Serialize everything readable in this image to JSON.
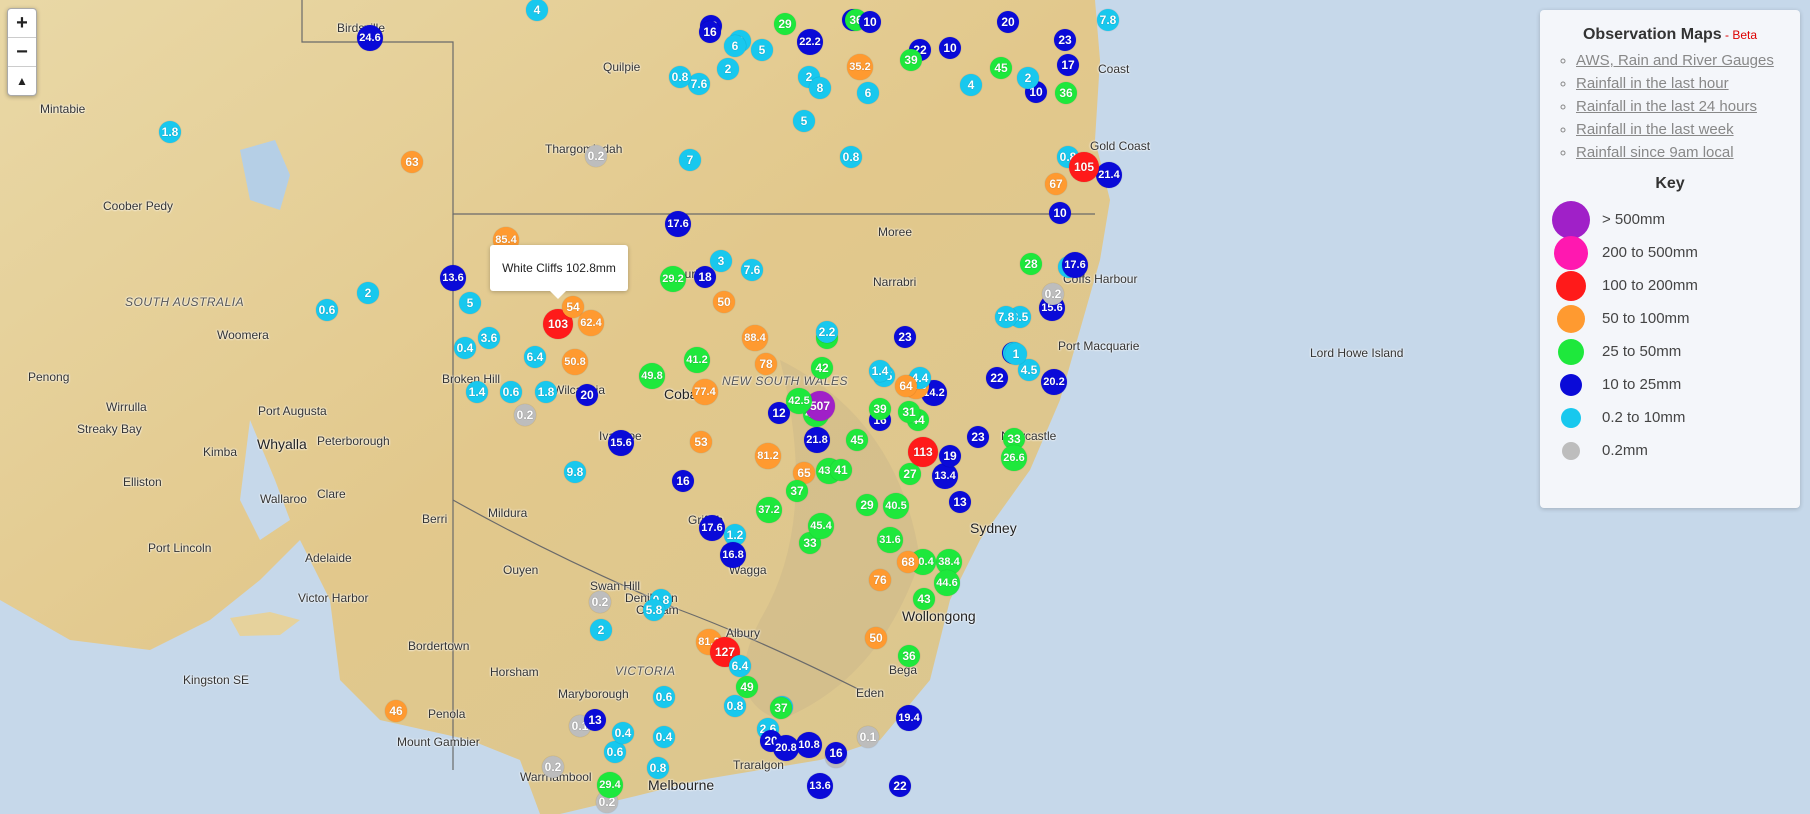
{
  "map": {
    "zoom_in": "+",
    "zoom_out": "−",
    "reset_north": "▲",
    "tooltip": "White Cliffs 102.8mm",
    "place_labels": [
      "Birdsville",
      "Quilpie",
      "Mintabie",
      "Thargomindah",
      "Coober Pedy",
      "SOUTH AUSTRALIA",
      "Woomera",
      "Penong",
      "Wirrulla",
      "Streaky Bay",
      "Port Augusta",
      "Whyalla",
      "Peterborough",
      "Kimba",
      "Elliston",
      "Wallaroo",
      "Clare",
      "Port Lincoln",
      "Adelaide",
      "Victor Harbor",
      "Kingston SE",
      "Bordertown",
      "Horsham",
      "Mount Gambier",
      "Penola",
      "Warrnambool",
      "Maryborough",
      "VICTORIA",
      "Cobram",
      "Deniliquin",
      "Swan Hill",
      "Ouyen",
      "Mildura",
      "Berri",
      "Broken Hill",
      "Wilcannia",
      "NEW SOUTH WALES",
      "Ivanhoe",
      "Cobar",
      "Moree",
      "Narrabri",
      "Griffith",
      "Wagga",
      "Albury",
      "Coffs Harbour",
      "Port Macquarie",
      "Newcastle",
      "Sydney",
      "Wollongong",
      "Eden",
      "Traralgon",
      "Melbourne",
      "Bega",
      "Lord Howe Island",
      "Coast",
      "Gold Coast",
      "Bourke"
    ],
    "markers": [
      {
        "v": "24.6",
        "c": "navy"
      },
      {
        "v": "4",
        "c": "cyan"
      },
      {
        "v": "1.8",
        "c": "cyan"
      },
      {
        "v": "63",
        "c": "orange"
      },
      {
        "v": "0.2",
        "c": "grey"
      },
      {
        "v": "7",
        "c": "cyan"
      },
      {
        "v": "0.8",
        "c": "cyan"
      },
      {
        "v": "2",
        "c": "cyan"
      },
      {
        "v": "0.6",
        "c": "cyan"
      },
      {
        "v": "13.6",
        "c": "navy"
      },
      {
        "v": "5",
        "c": "cyan"
      },
      {
        "v": "85.4",
        "c": "orange"
      },
      {
        "v": "3.6",
        "c": "cyan"
      },
      {
        "v": "0.4",
        "c": "cyan"
      },
      {
        "v": "1.4",
        "c": "cyan"
      },
      {
        "v": "0.6",
        "c": "cyan"
      },
      {
        "v": "0.2",
        "c": "grey"
      },
      {
        "v": "1.8",
        "c": "cyan"
      },
      {
        "v": "20",
        "c": "navy"
      },
      {
        "v": "6.4",
        "c": "cyan"
      },
      {
        "v": "50.8",
        "c": "orange"
      },
      {
        "v": "103",
        "c": "red"
      },
      {
        "v": "54",
        "c": "orange"
      },
      {
        "v": "62.4",
        "c": "orange"
      },
      {
        "v": "17.6",
        "c": "navy"
      },
      {
        "v": "3",
        "c": "cyan"
      },
      {
        "v": "29.2",
        "c": "green"
      },
      {
        "v": "18",
        "c": "navy"
      },
      {
        "v": "7.6",
        "c": "cyan"
      },
      {
        "v": "50",
        "c": "orange"
      },
      {
        "v": "88.4",
        "c": "orange"
      },
      {
        "v": "78",
        "c": "orange"
      },
      {
        "v": "49.8",
        "c": "green"
      },
      {
        "v": "41.2",
        "c": "green"
      },
      {
        "v": "77.4",
        "c": "orange"
      },
      {
        "v": "53",
        "c": "orange"
      },
      {
        "v": "15.6",
        "c": "navy"
      },
      {
        "v": "9.8",
        "c": "cyan"
      },
      {
        "v": "16",
        "c": "navy"
      },
      {
        "v": "81.2",
        "c": "orange"
      },
      {
        "v": "65",
        "c": "orange"
      },
      {
        "v": "37.2",
        "c": "green"
      },
      {
        "v": "17.6",
        "c": "navy"
      },
      {
        "v": "1.2",
        "c": "cyan"
      },
      {
        "v": "16.8",
        "c": "navy"
      },
      {
        "v": "0.8",
        "c": "cyan"
      },
      {
        "v": "5.8",
        "c": "cyan"
      },
      {
        "v": "2",
        "c": "cyan"
      },
      {
        "v": "0.1",
        "c": "grey"
      },
      {
        "v": "0.2",
        "c": "grey"
      },
      {
        "v": "0.2",
        "c": "grey"
      },
      {
        "v": "0.6",
        "c": "cyan"
      },
      {
        "v": "0.4",
        "c": "cyan"
      },
      {
        "v": "0.8",
        "c": "cyan"
      },
      {
        "v": "0.6",
        "c": "cyan"
      },
      {
        "v": "0.2",
        "c": "grey"
      },
      {
        "v": "0.4",
        "c": "cyan"
      },
      {
        "v": "0.8",
        "c": "cyan"
      },
      {
        "v": "3.8",
        "c": "cyan"
      },
      {
        "v": "0.2",
        "c": "grey"
      },
      {
        "v": "0.1",
        "c": "grey"
      },
      {
        "v": "22",
        "c": "navy"
      },
      {
        "v": "29.4",
        "c": "green"
      },
      {
        "v": "13",
        "c": "navy"
      },
      {
        "v": "46",
        "c": "orange"
      },
      {
        "v": "81.2",
        "c": "orange"
      },
      {
        "v": "127",
        "c": "red"
      },
      {
        "v": "6.4",
        "c": "cyan"
      },
      {
        "v": "49",
        "c": "green"
      },
      {
        "v": "37",
        "c": "green"
      },
      {
        "v": "2.6",
        "c": "cyan"
      },
      {
        "v": "20",
        "c": "navy"
      },
      {
        "v": "20.8",
        "c": "navy"
      },
      {
        "v": "10.8",
        "c": "navy"
      },
      {
        "v": "13.6",
        "c": "navy"
      },
      {
        "v": "16",
        "c": "navy"
      },
      {
        "v": "19.4",
        "c": "navy"
      },
      {
        "v": "36",
        "c": "green"
      },
      {
        "v": "50",
        "c": "orange"
      },
      {
        "v": "43",
        "c": "green"
      },
      {
        "v": "38.4",
        "c": "green"
      },
      {
        "v": "44.6",
        "c": "green"
      },
      {
        "v": "30.4",
        "c": "green"
      },
      {
        "v": "68",
        "c": "orange"
      },
      {
        "v": "76",
        "c": "orange"
      },
      {
        "v": "33",
        "c": "green"
      },
      {
        "v": "45.4",
        "c": "green"
      },
      {
        "v": "31.6",
        "c": "green"
      },
      {
        "v": "29",
        "c": "green"
      },
      {
        "v": "43.2",
        "c": "green"
      },
      {
        "v": "21.8",
        "c": "navy"
      },
      {
        "v": "48.4",
        "c": "green"
      },
      {
        "v": "37",
        "c": "green"
      },
      {
        "v": "41",
        "c": "green"
      },
      {
        "v": "45",
        "c": "green"
      },
      {
        "v": "40.5",
        "c": "green"
      },
      {
        "v": "27",
        "c": "green"
      },
      {
        "v": "13.4",
        "c": "navy"
      },
      {
        "v": "13",
        "c": "navy"
      },
      {
        "v": "23",
        "c": "navy"
      },
      {
        "v": "19",
        "c": "navy"
      },
      {
        "v": "113",
        "c": "red"
      },
      {
        "v": "44",
        "c": "green"
      },
      {
        "v": "33",
        "c": "green"
      },
      {
        "v": "26.6",
        "c": "green"
      },
      {
        "v": "16",
        "c": "navy"
      },
      {
        "v": "31",
        "c": "green"
      },
      {
        "v": "39",
        "c": "green"
      },
      {
        "v": "14.2",
        "c": "navy"
      },
      {
        "v": "51.6",
        "c": "orange"
      },
      {
        "v": "4.4",
        "c": "cyan"
      },
      {
        "v": "42",
        "c": "green"
      },
      {
        "v": "507",
        "c": "purple"
      },
      {
        "v": "2.5",
        "c": "cyan"
      },
      {
        "v": "64",
        "c": "orange"
      },
      {
        "v": "12",
        "c": "navy"
      },
      {
        "v": "42.5",
        "c": "green"
      },
      {
        "v": "35",
        "c": "green"
      },
      {
        "v": "23",
        "c": "navy"
      },
      {
        "v": "22",
        "c": "navy"
      },
      {
        "v": "10",
        "c": "navy"
      },
      {
        "v": "4.5",
        "c": "cyan"
      },
      {
        "v": "3.5",
        "c": "cyan"
      },
      {
        "v": "15.6",
        "c": "navy"
      },
      {
        "v": "9.8",
        "c": "cyan"
      },
      {
        "v": "7.8",
        "c": "cyan"
      },
      {
        "v": "1.4",
        "c": "cyan"
      },
      {
        "v": "2",
        "c": "cyan"
      },
      {
        "v": "1",
        "c": "cyan"
      },
      {
        "v": "0.2",
        "c": "grey"
      },
      {
        "v": "17.6",
        "c": "navy"
      },
      {
        "v": "20.2",
        "c": "navy"
      },
      {
        "v": "28",
        "c": "green"
      },
      {
        "v": "10",
        "c": "navy"
      },
      {
        "v": "0.8",
        "c": "cyan"
      },
      {
        "v": "2.2",
        "c": "cyan"
      },
      {
        "v": "21.4",
        "c": "navy"
      },
      {
        "v": "105",
        "c": "red"
      },
      {
        "v": "67",
        "c": "orange"
      },
      {
        "v": "36",
        "c": "green"
      },
      {
        "v": "23",
        "c": "navy"
      },
      {
        "v": "17",
        "c": "navy"
      },
      {
        "v": "45",
        "c": "green"
      },
      {
        "v": "10",
        "c": "navy"
      },
      {
        "v": "20",
        "c": "navy"
      },
      {
        "v": "18",
        "c": "navy"
      },
      {
        "v": "22.2",
        "c": "navy"
      },
      {
        "v": "36",
        "c": "green"
      },
      {
        "v": "35.2",
        "c": "orange"
      },
      {
        "v": "22",
        "c": "navy"
      },
      {
        "v": "29",
        "c": "green"
      },
      {
        "v": "2",
        "c": "cyan"
      },
      {
        "v": "6",
        "c": "cyan"
      },
      {
        "v": "39",
        "c": "green"
      },
      {
        "v": "8",
        "c": "cyan"
      },
      {
        "v": "4",
        "c": "cyan"
      },
      {
        "v": "10",
        "c": "navy"
      },
      {
        "v": "5",
        "c": "cyan"
      },
      {
        "v": "7.8",
        "c": "cyan"
      },
      {
        "v": "10",
        "c": "navy"
      },
      {
        "v": "2",
        "c": "cyan"
      },
      {
        "v": "7.6",
        "c": "cyan"
      },
      {
        "v": "2",
        "c": "cyan"
      },
      {
        "v": "6",
        "c": "cyan"
      },
      {
        "v": "5",
        "c": "cyan"
      },
      {
        "v": "0.8",
        "c": "cyan"
      },
      {
        "v": "10",
        "c": "navy"
      },
      {
        "v": "2",
        "c": "cyan"
      },
      {
        "v": "16",
        "c": "navy"
      },
      {
        "v": "6",
        "c": "cyan"
      },
      {
        "v": "10",
        "c": "navy"
      },
      {
        "v": "1.2",
        "c": "cyan"
      },
      {
        "v": "0.2",
        "c": "grey"
      }
    ]
  },
  "panel": {
    "title": "Observation Maps",
    "beta": " - Beta",
    "links": [
      "AWS, Rain and River Gauges",
      "Rainfall in the last hour",
      "Rainfall in the last 24 hours",
      "Rainfall in the last week",
      "Rainfall since 9am local"
    ],
    "key_title": "Key",
    "key": [
      {
        "label": "> 500mm",
        "color": "#a020c8"
      },
      {
        "label": "200 to 500mm",
        "color": "#ff18b0"
      },
      {
        "label": "100 to 200mm",
        "color": "#ff1a1a"
      },
      {
        "label": "50 to 100mm",
        "color": "#ff9a30"
      },
      {
        "label": "25 to 50mm",
        "color": "#1ee83c"
      },
      {
        "label": "10 to 25mm",
        "color": "#0a0ad8"
      },
      {
        "label": "0.2 to 10mm",
        "color": "#18c8ee"
      },
      {
        "label": "0.2mm",
        "color": "#bdbdbd"
      }
    ]
  },
  "colors": {
    "navy": "#0a0ad8",
    "cyan": "#18c8ee",
    "green": "#1ee83c",
    "orange": "#ff9a30",
    "red": "#ff1a1a",
    "purple": "#a020c8",
    "grey": "#bdbdbd"
  }
}
